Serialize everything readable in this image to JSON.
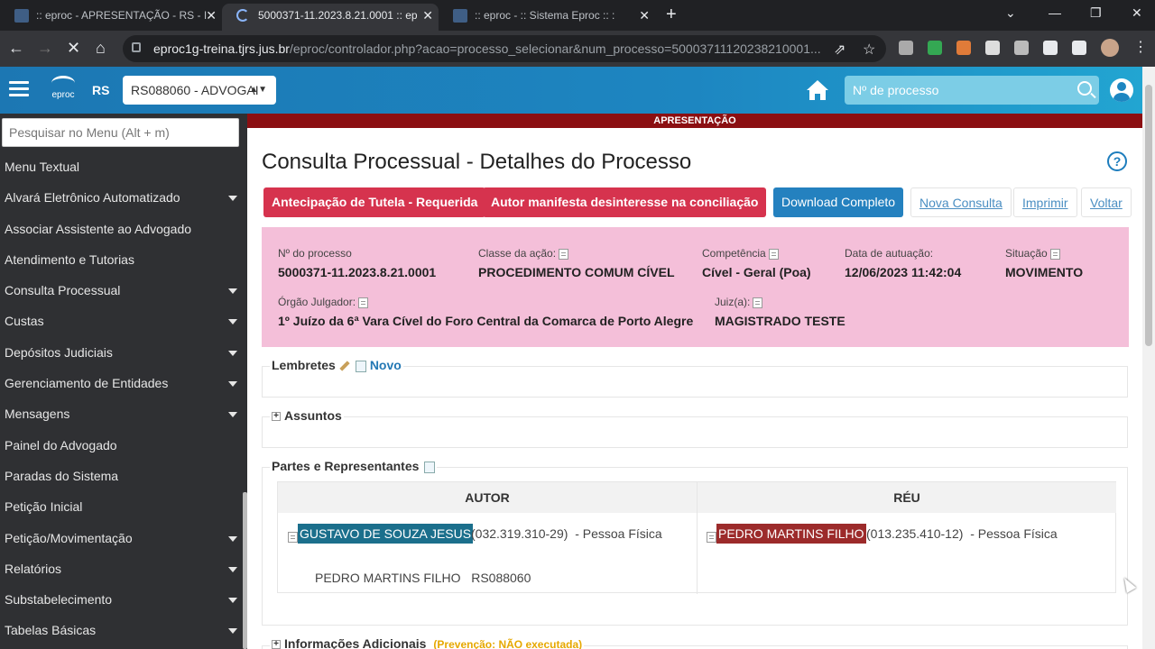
{
  "browser": {
    "tabs": [
      {
        "title": ":: eproc - APRESENTAÇÃO - RS - I",
        "active": false
      },
      {
        "title": "5000371-11.2023.8.21.0001 :: ep",
        "active": true
      },
      {
        "title": ":: eproc - :: Sistema Eproc :: :",
        "active": false
      }
    ],
    "url_host": "eproc1g-treina.tjrs.jus.br",
    "url_path": "/eproc/controlador.php?acao=processo_selecionar&num_processo=50003711120238210001..."
  },
  "header": {
    "logo_text": "eproc",
    "state": "RS",
    "user_select_value": "RS088060 - ADVOGAI",
    "search_placeholder": "Nº de processo"
  },
  "sidebar": {
    "search_placeholder": "Pesquisar no Menu (Alt + m)",
    "items": [
      {
        "label": "Menu Textual",
        "has_children": false
      },
      {
        "label": "Alvará Eletrônico Automatizado",
        "has_children": true
      },
      {
        "label": "Associar Assistente ao Advogado",
        "has_children": false
      },
      {
        "label": "Atendimento e Tutorias",
        "has_children": false
      },
      {
        "label": "Consulta Processual",
        "has_children": true
      },
      {
        "label": "Custas",
        "has_children": true
      },
      {
        "label": "Depósitos Judiciais",
        "has_children": true
      },
      {
        "label": "Gerenciamento de Entidades",
        "has_children": true
      },
      {
        "label": "Mensagens",
        "has_children": true
      },
      {
        "label": "Painel do Advogado",
        "has_children": false
      },
      {
        "label": "Paradas do Sistema",
        "has_children": false
      },
      {
        "label": "Petição Inicial",
        "has_children": false
      },
      {
        "label": "Petição/Movimentação",
        "has_children": true
      },
      {
        "label": "Relatórios",
        "has_children": true
      },
      {
        "label": "Substabelecimento",
        "has_children": true
      },
      {
        "label": "Tabelas Básicas",
        "has_children": true
      }
    ]
  },
  "main": {
    "env_banner": "APRESENTAÇÃO",
    "title": "Consulta Processual - Detalhes do Processo",
    "help_label": "?",
    "flags": [
      "Antecipação de Tutela - Requerida",
      "Autor manifesta desinteresse na conciliação"
    ],
    "actions": {
      "download": "Download Completo",
      "new_query": "Nova Consulta",
      "print": "Imprimir",
      "back": "Voltar"
    },
    "process": {
      "number_label": "Nº do processo",
      "number": "5000371-11.2023.8.21.0001",
      "class_label": "Classe da ação:",
      "class": "PROCEDIMENTO COMUM CÍVEL",
      "competence_label": "Competência",
      "competence": "Cível - Geral (Poa)",
      "date_label": "Data de autuação:",
      "date": "12/06/2023 11:42:04",
      "status_label": "Situação",
      "status": "MOVIMENTO",
      "court_label": "Órgão Julgador:",
      "court": "1º Juízo da 6ª Vara Cível do Foro Central da Comarca de Porto Alegre",
      "judge_label": "Juiz(a):",
      "judge": "MAGISTRADO TESTE"
    },
    "reminders": {
      "title": "Lembretes",
      "new_label": "Novo"
    },
    "subjects": {
      "title": "Assuntos"
    },
    "parties": {
      "title": "Partes e Representantes",
      "author_header": "AUTOR",
      "defendant_header": "RÉU",
      "author_name": "GUSTAVO DE SOUZA JESUS",
      "author_doc": "(032.319.310-29)",
      "author_type": "- Pessoa Física",
      "author_lawyer": "PEDRO MARTINS FILHO",
      "author_lawyer_oab": "RS088060",
      "defendant_name": "PEDRO MARTINS FILHO",
      "defendant_doc": "(013.235.410-12)",
      "defendant_type": "- Pessoa Física"
    },
    "additional": {
      "title": "Informações Adicionais",
      "prevention": "(Prevenção: NÃO executada)"
    }
  },
  "colors": {
    "header": "#1d86c1",
    "sidebar": "#2f3033",
    "flag": "#d6334e",
    "process_box": "#f4bfd9",
    "banner": "#8b0f12"
  }
}
